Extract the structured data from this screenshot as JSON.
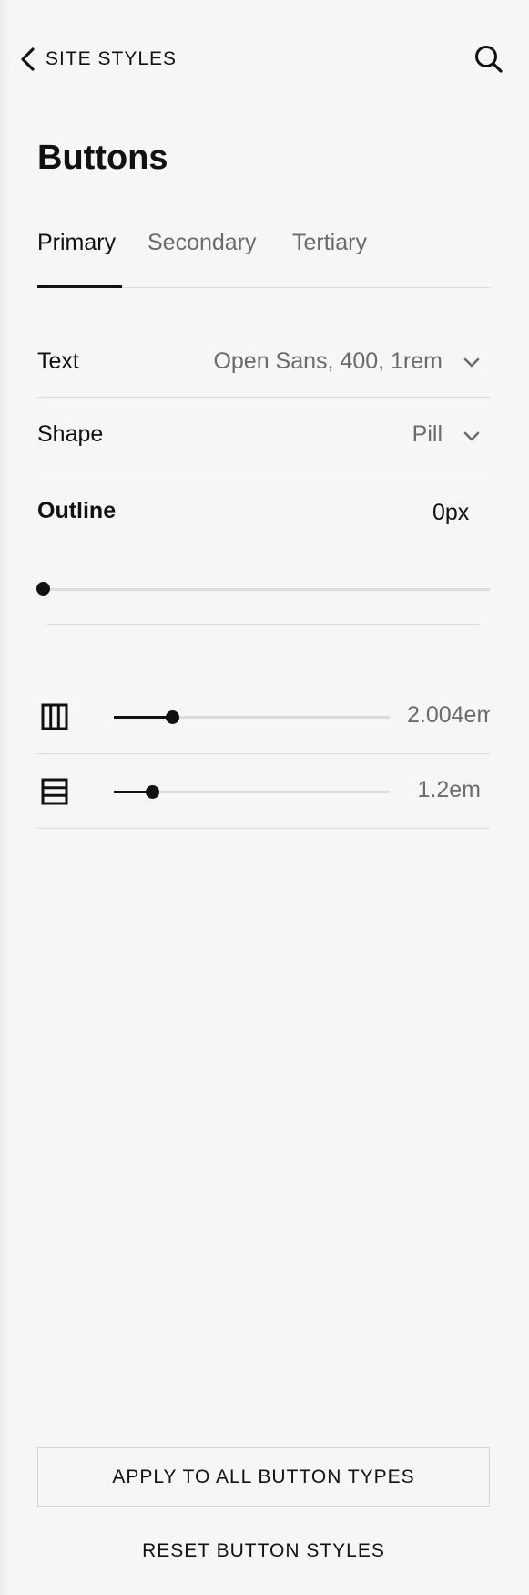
{
  "header": {
    "back_label": "SITE STYLES",
    "back_icon": "chevron-left-icon",
    "search_icon": "search-icon"
  },
  "page_title": "Buttons",
  "tabs": [
    {
      "label": "Primary",
      "active": true
    },
    {
      "label": "Secondary",
      "active": false
    },
    {
      "label": "Tertiary",
      "active": false
    }
  ],
  "text_setting": {
    "label": "Text",
    "value": "Open Sans, 400, 1rem"
  },
  "shape_setting": {
    "label": "Shape",
    "value": "Pill"
  },
  "outline": {
    "label": "Outline",
    "value": "0px",
    "level": 0
  },
  "padding": {
    "horizontal": {
      "icon": "columns-icon",
      "value": "2.004em",
      "level": 0.21
    },
    "vertical": {
      "icon": "rows-icon",
      "value": "1.2em",
      "level": 0.14
    }
  },
  "actions": {
    "apply_all": "APPLY TO ALL BUTTON TYPES",
    "reset": "RESET BUTTON STYLES"
  },
  "colors": {
    "background": "#f6f6f6",
    "text": "#111111",
    "muted": "#6b6b6b",
    "divider": "#dcdcdc"
  }
}
